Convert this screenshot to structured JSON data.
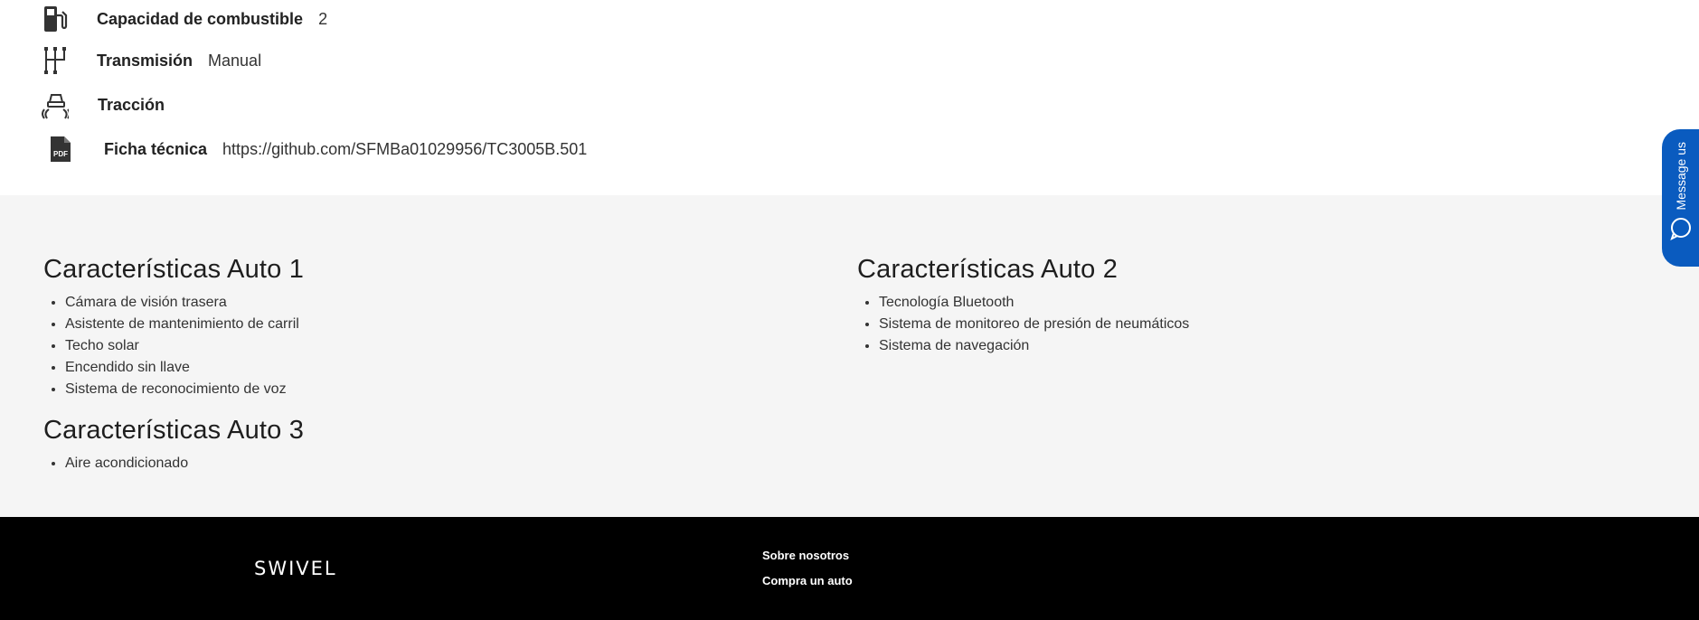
{
  "specs": [
    {
      "label": "Capacidad de combustible",
      "value": "2",
      "icon": "fuel-pump-icon"
    },
    {
      "label": "Transmisión",
      "value": "Manual",
      "icon": "gear-shift-icon"
    },
    {
      "label": "Tracción",
      "value": "",
      "icon": "traction-control-icon"
    },
    {
      "label": "Ficha técnica",
      "value": "https://github.com/SFMBa01029956/TC3005B.501",
      "icon": "pdf-file-icon",
      "icon_text": "PDF"
    }
  ],
  "features": [
    {
      "title": "Características Auto 1",
      "items": [
        "Cámara de visión trasera",
        "Asistente de mantenimiento de carril",
        "Techo solar",
        "Encendido sin llave",
        "Sistema de reconocimiento de voz"
      ]
    },
    {
      "title": "Características Auto 2",
      "items": [
        "Tecnología Bluetooth",
        "Sistema de monitoreo de presión de neumáticos",
        "Sistema de navegación"
      ]
    },
    {
      "title": "Características Auto 3",
      "items": [
        "Aire acondicionado"
      ]
    }
  ],
  "footer": {
    "logo": "SWIVEL",
    "links": [
      "Sobre nosotros",
      "Compra un auto"
    ]
  },
  "message_tab": {
    "label": "Message us",
    "icon": "chat-bubble-icon",
    "color": "#0a5bbf"
  }
}
